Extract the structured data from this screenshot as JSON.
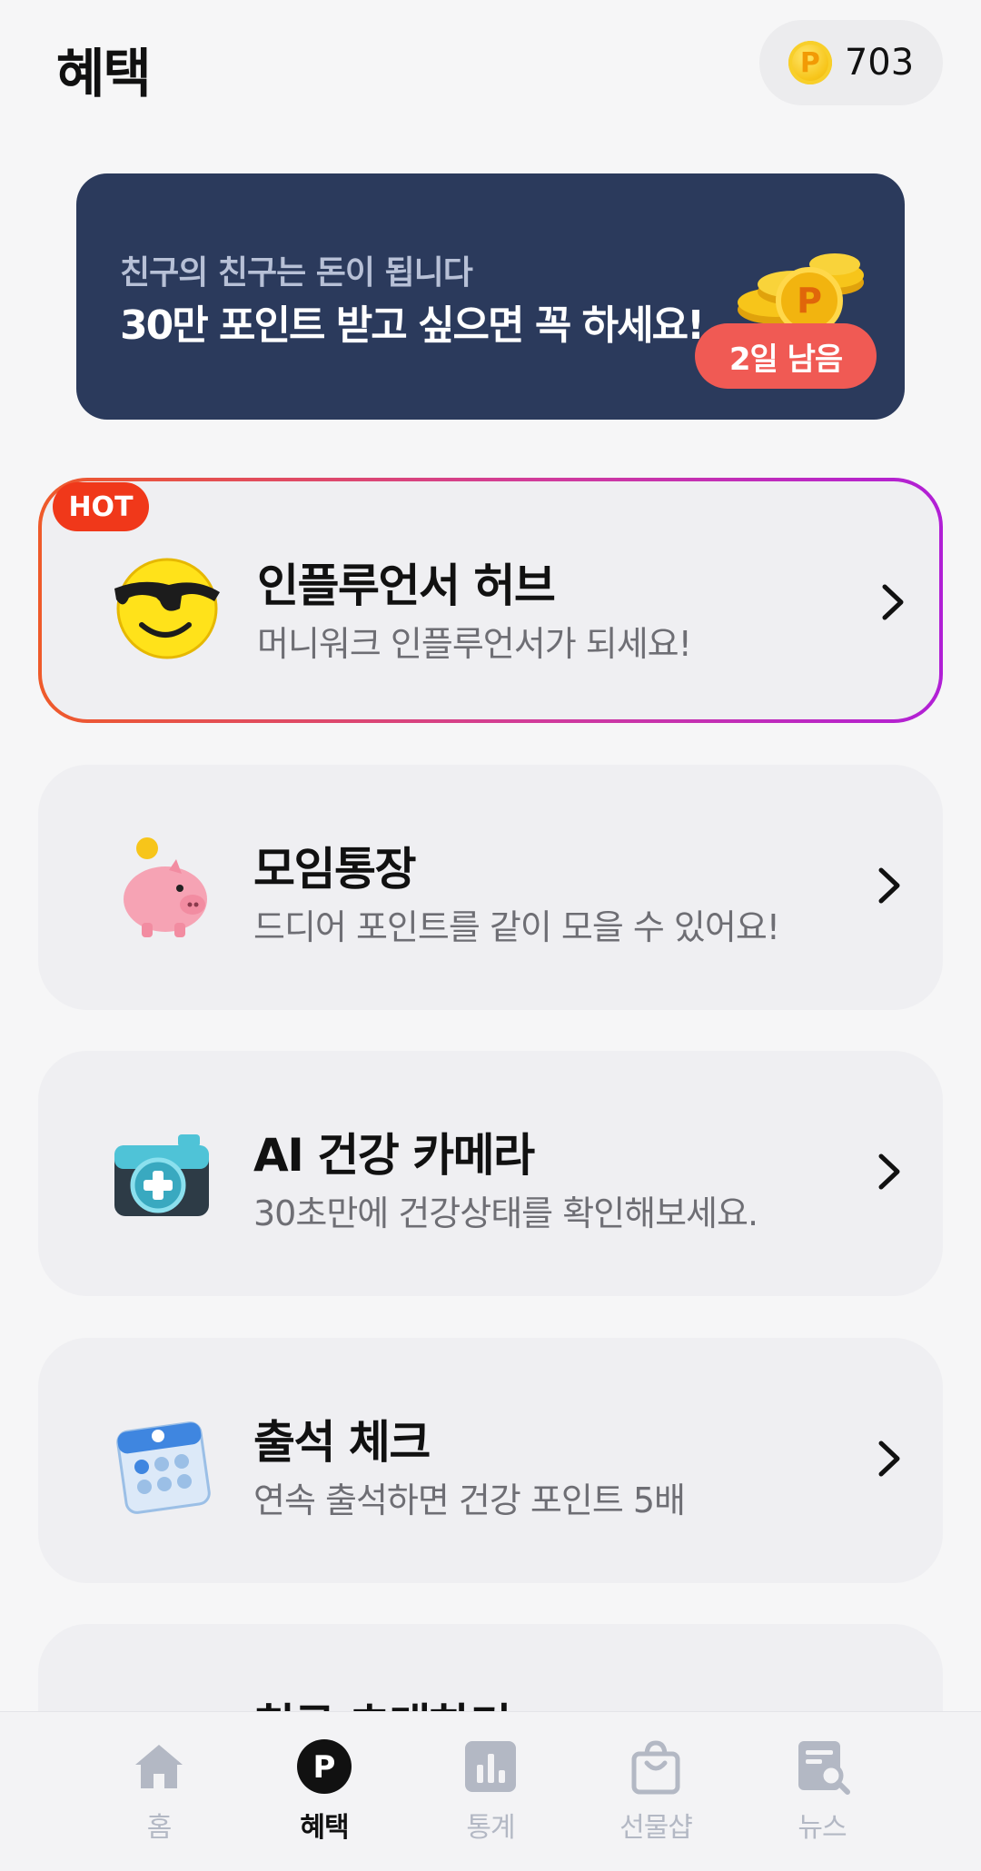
{
  "header": {
    "title": "혜택",
    "points": "703",
    "coin_letter": "P"
  },
  "banner": {
    "subtitle": "친구의 친구는 돈이 됩니다",
    "title": "30만 포인트 받고 싶으면 꼭 하세요!",
    "days_left": "2일 남음",
    "coin_letter": "P"
  },
  "cards": [
    {
      "badge": "HOT",
      "title": "인플루언서 허브",
      "desc": "머니워크 인플루언서가 되세요!",
      "icon": "sunglasses-smiley-icon"
    },
    {
      "title": "모임통장",
      "desc": "드디어 포인트를 같이 모을 수 있어요!",
      "icon": "piggy-bank-icon"
    },
    {
      "title": "AI 건강 카메라",
      "desc": "30초만에 건강상태를 확인해보세요.",
      "icon": "health-camera-icon"
    },
    {
      "title": "출석 체크",
      "desc": "연속 출석하면 건강 포인트 5배",
      "icon": "calendar-icon"
    },
    {
      "title": "친구 초대하기",
      "icon": "invite-friend-icon"
    }
  ],
  "nav": [
    {
      "label": "홈",
      "icon": "home-icon"
    },
    {
      "label": "혜택",
      "icon": "points-icon",
      "active": true,
      "icon_letter": "P"
    },
    {
      "label": "통계",
      "icon": "stats-icon"
    },
    {
      "label": "선물샵",
      "icon": "shopping-bag-icon"
    },
    {
      "label": "뉴스",
      "icon": "news-search-icon"
    }
  ],
  "colors": {
    "banner_bg": "#2b3a5c",
    "badge_red": "#f05a54",
    "hot_badge": "#f0381a",
    "nav_inactive": "#b3b8c4",
    "card_bg": "#efeff2"
  }
}
